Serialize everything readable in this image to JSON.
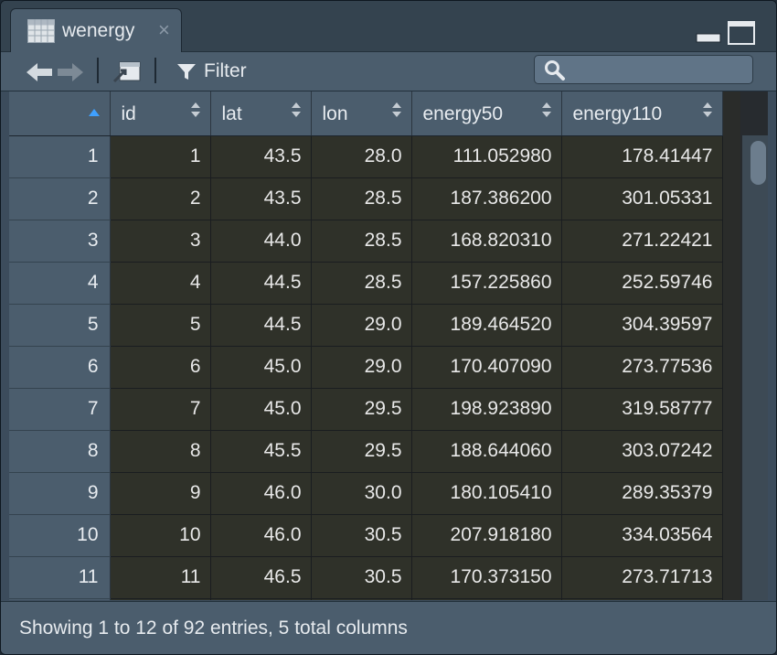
{
  "tab": {
    "title": "wenergy",
    "close_glyph": "×",
    "icon": "table-grid-icon"
  },
  "toolbar": {
    "filter_label": "Filter",
    "search_placeholder": "",
    "search_value": ""
  },
  "columns": [
    "",
    "id",
    "lat",
    "lon",
    "energy50",
    "energy110"
  ],
  "sorted_column": 0,
  "rows": [
    [
      "1",
      "1",
      "43.5",
      "28.0",
      "111.052980",
      "178.41447"
    ],
    [
      "2",
      "2",
      "43.5",
      "28.5",
      "187.386200",
      "301.05331"
    ],
    [
      "3",
      "3",
      "44.0",
      "28.5",
      "168.820310",
      "271.22421"
    ],
    [
      "4",
      "4",
      "44.5",
      "28.5",
      "157.225860",
      "252.59746"
    ],
    [
      "5",
      "5",
      "44.5",
      "29.0",
      "189.464520",
      "304.39597"
    ],
    [
      "6",
      "6",
      "45.0",
      "29.0",
      "170.407090",
      "273.77536"
    ],
    [
      "7",
      "7",
      "45.0",
      "29.5",
      "198.923890",
      "319.58777"
    ],
    [
      "8",
      "8",
      "45.5",
      "29.5",
      "188.644060",
      "303.07242"
    ],
    [
      "9",
      "9",
      "46.0",
      "30.0",
      "180.105410",
      "289.35379"
    ],
    [
      "10",
      "10",
      "46.0",
      "30.5",
      "207.918180",
      "334.03564"
    ],
    [
      "11",
      "11",
      "46.5",
      "30.5",
      "170.373150",
      "273.71713"
    ]
  ],
  "status": {
    "text": "Showing 1 to 12 of 92 entries, 5 total columns"
  },
  "colors": {
    "panel": "#4b5d6d",
    "cell": "#2f3129",
    "sort_active": "#3fa0ff"
  }
}
